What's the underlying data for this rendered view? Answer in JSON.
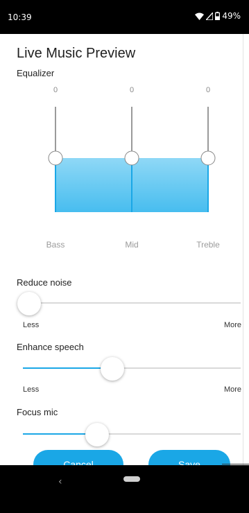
{
  "status_bar": {
    "time": "10:39",
    "battery": "49%",
    "icons": [
      "wifi-icon",
      "cell-signal-icon",
      "battery-icon"
    ]
  },
  "title": "Live Music Preview",
  "equalizer": {
    "label": "Equalizer",
    "bands": [
      {
        "name": "Bass",
        "value": "0"
      },
      {
        "name": "Mid",
        "value": "0"
      },
      {
        "name": "Treble",
        "value": "0"
      }
    ],
    "fill_color": "#8fd8f6",
    "line_color": "#1aa7e6"
  },
  "reduce_noise": {
    "label": "Reduce noise",
    "min_label": "Less",
    "max_label": "More",
    "level": 0.03
  },
  "enhance_speech": {
    "label": "Enhance speech",
    "min_label": "Less",
    "max_label": "More",
    "level": 0.41
  },
  "focus_mic": {
    "label": "Focus mic",
    "level": 0.34
  },
  "buttons": {
    "cancel": "Cancel",
    "save": "Save"
  },
  "nav": {
    "back_glyph": "‹"
  },
  "accent_color": "#1aa7e6"
}
